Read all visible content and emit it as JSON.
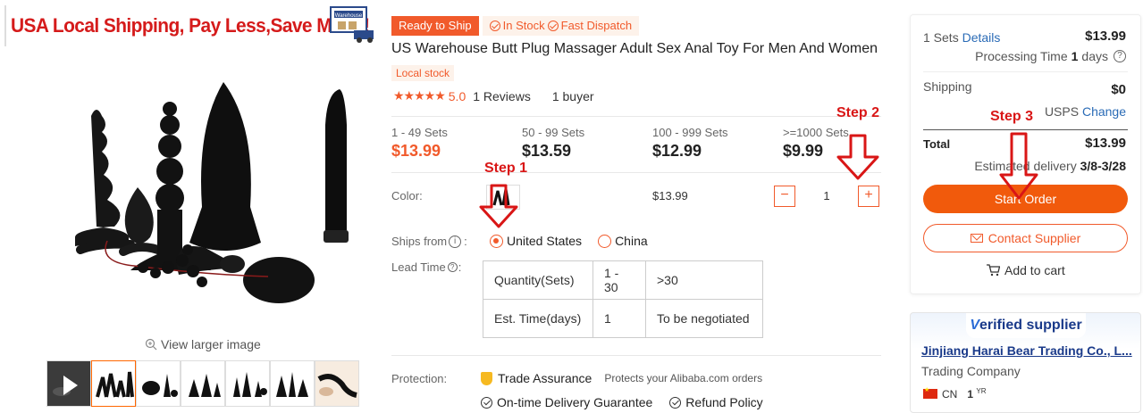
{
  "banner": {
    "text": "USA Local Shipping, Pay Less,Save More !",
    "truck_label": "Warehouse"
  },
  "gallery": {
    "view_larger": "View larger image",
    "thumbnails": [
      "video",
      "image-1",
      "image-2",
      "image-3",
      "image-4",
      "image-5",
      "image-6"
    ]
  },
  "badges": {
    "ready": "Ready to Ship",
    "in_stock": "In Stock",
    "fast_dispatch": "Fast Dispatch"
  },
  "product": {
    "title": "US Warehouse Butt Plug Massager Adult Sex Anal Toy For Men And Women",
    "local_stock": "Local stock",
    "rating": "5.0",
    "reviews": "1 Reviews",
    "buyers": "1 buyer"
  },
  "tiers": [
    {
      "qty": "1 - 49 Sets",
      "price": "$13.99"
    },
    {
      "qty": "50 - 99 Sets",
      "price": "$13.59"
    },
    {
      "qty": "100 - 999 Sets",
      "price": "$12.99"
    },
    {
      "qty": ">=1000 Sets",
      "price": "$9.99"
    }
  ],
  "options": {
    "color_label": "Color:",
    "unit_price": "$13.99",
    "quantity": "1",
    "minus": "−",
    "plus": "+",
    "ships_from_label": "Ships from",
    "ships_from_suffix": ":",
    "ships": [
      "United States",
      "China"
    ],
    "ships_selected": 0,
    "lead_time_label": "Lead Time"
  },
  "lead_table": {
    "rows": [
      [
        "Quantity(Sets)",
        "1 - 30",
        ">30"
      ],
      [
        "Est. Time(days)",
        "1",
        "To be negotiated"
      ]
    ]
  },
  "protection": {
    "label": "Protection:",
    "trade_assurance": "Trade Assurance",
    "trade_sub": "Protects your Alibaba.com orders",
    "delivery": "On-time Delivery Guarantee",
    "refund": "Refund Policy"
  },
  "order": {
    "sets": "1 Sets",
    "details": "Details",
    "price": "$13.99",
    "processing_prefix": "Processing Time",
    "processing_num": "1",
    "processing_suffix": "days",
    "shipping_label": "Shipping",
    "shipping_val": "$0",
    "carrier": "USPS",
    "change": "Change",
    "total_label": "Total",
    "total_val": "$13.99",
    "delivery_prefix": "Estimated delivery",
    "delivery_dates": "3/8-3/28",
    "start_order": "Start Order",
    "contact": "Contact Supplier",
    "add_cart": "Add to cart"
  },
  "supplier": {
    "verified_v": "V",
    "verified_rest": "erified supplier",
    "name": "Jinjiang Harai Bear Trading Co., L...",
    "type": "Trading Company",
    "country": "CN",
    "years": "1",
    "years_unit": "YR"
  },
  "steps": [
    "Step 1",
    "Step 2",
    "Step 3"
  ],
  "colors": {
    "accent": "#f15a2b",
    "step_red": "#d91616",
    "link": "#2a6bb6"
  }
}
